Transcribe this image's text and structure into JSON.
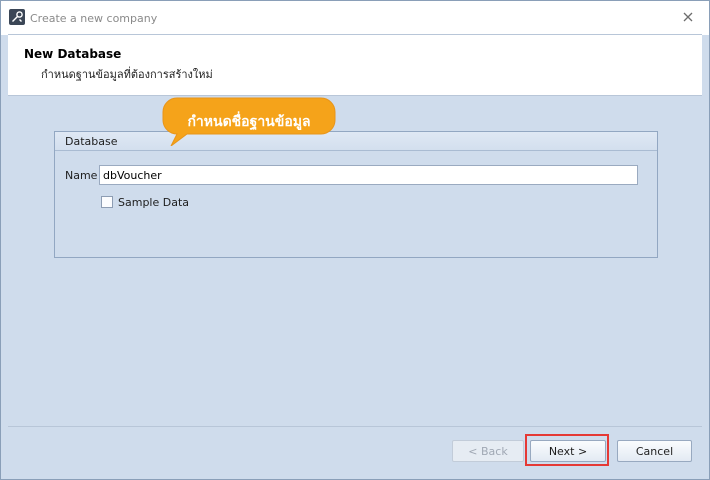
{
  "window": {
    "title": "Create a new company"
  },
  "header": {
    "title": "New Database",
    "subtitle": "กำหนดฐานข้อมูลที่ต้องการสร้างใหม่"
  },
  "database_group": {
    "title": "Database",
    "name_label": "Name",
    "name_value": "dbVoucher",
    "sample_data_label": "Sample Data",
    "sample_data_checked": false
  },
  "callout": {
    "text": "กำหนดชื่อฐานข้อมูล",
    "color": "#f5a31a"
  },
  "footer": {
    "back_label": "< Back",
    "next_label": "Next >",
    "cancel_label": "Cancel",
    "highlight_color": "#e53935"
  },
  "icons": {
    "app": "tools-icon",
    "close": "close-icon"
  }
}
